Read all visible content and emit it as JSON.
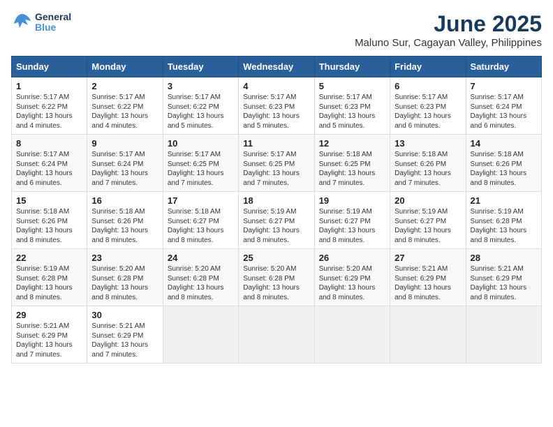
{
  "logo": {
    "line1": "General",
    "line2": "Blue"
  },
  "title": "June 2025",
  "location": "Maluno Sur, Cagayan Valley, Philippines",
  "days_header": [
    "Sunday",
    "Monday",
    "Tuesday",
    "Wednesday",
    "Thursday",
    "Friday",
    "Saturday"
  ],
  "weeks": [
    [
      {
        "day": "1",
        "sunrise": "5:17 AM",
        "sunset": "6:22 PM",
        "daylight": "13 hours and 4 minutes."
      },
      {
        "day": "2",
        "sunrise": "5:17 AM",
        "sunset": "6:22 PM",
        "daylight": "13 hours and 4 minutes."
      },
      {
        "day": "3",
        "sunrise": "5:17 AM",
        "sunset": "6:22 PM",
        "daylight": "13 hours and 5 minutes."
      },
      {
        "day": "4",
        "sunrise": "5:17 AM",
        "sunset": "6:23 PM",
        "daylight": "13 hours and 5 minutes."
      },
      {
        "day": "5",
        "sunrise": "5:17 AM",
        "sunset": "6:23 PM",
        "daylight": "13 hours and 5 minutes."
      },
      {
        "day": "6",
        "sunrise": "5:17 AM",
        "sunset": "6:23 PM",
        "daylight": "13 hours and 6 minutes."
      },
      {
        "day": "7",
        "sunrise": "5:17 AM",
        "sunset": "6:24 PM",
        "daylight": "13 hours and 6 minutes."
      }
    ],
    [
      {
        "day": "8",
        "sunrise": "5:17 AM",
        "sunset": "6:24 PM",
        "daylight": "13 hours and 6 minutes."
      },
      {
        "day": "9",
        "sunrise": "5:17 AM",
        "sunset": "6:24 PM",
        "daylight": "13 hours and 7 minutes."
      },
      {
        "day": "10",
        "sunrise": "5:17 AM",
        "sunset": "6:25 PM",
        "daylight": "13 hours and 7 minutes."
      },
      {
        "day": "11",
        "sunrise": "5:17 AM",
        "sunset": "6:25 PM",
        "daylight": "13 hours and 7 minutes."
      },
      {
        "day": "12",
        "sunrise": "5:18 AM",
        "sunset": "6:25 PM",
        "daylight": "13 hours and 7 minutes."
      },
      {
        "day": "13",
        "sunrise": "5:18 AM",
        "sunset": "6:26 PM",
        "daylight": "13 hours and 7 minutes."
      },
      {
        "day": "14",
        "sunrise": "5:18 AM",
        "sunset": "6:26 PM",
        "daylight": "13 hours and 8 minutes."
      }
    ],
    [
      {
        "day": "15",
        "sunrise": "5:18 AM",
        "sunset": "6:26 PM",
        "daylight": "13 hours and 8 minutes."
      },
      {
        "day": "16",
        "sunrise": "5:18 AM",
        "sunset": "6:26 PM",
        "daylight": "13 hours and 8 minutes."
      },
      {
        "day": "17",
        "sunrise": "5:18 AM",
        "sunset": "6:27 PM",
        "daylight": "13 hours and 8 minutes."
      },
      {
        "day": "18",
        "sunrise": "5:19 AM",
        "sunset": "6:27 PM",
        "daylight": "13 hours and 8 minutes."
      },
      {
        "day": "19",
        "sunrise": "5:19 AM",
        "sunset": "6:27 PM",
        "daylight": "13 hours and 8 minutes."
      },
      {
        "day": "20",
        "sunrise": "5:19 AM",
        "sunset": "6:27 PM",
        "daylight": "13 hours and 8 minutes."
      },
      {
        "day": "21",
        "sunrise": "5:19 AM",
        "sunset": "6:28 PM",
        "daylight": "13 hours and 8 minutes."
      }
    ],
    [
      {
        "day": "22",
        "sunrise": "5:19 AM",
        "sunset": "6:28 PM",
        "daylight": "13 hours and 8 minutes."
      },
      {
        "day": "23",
        "sunrise": "5:20 AM",
        "sunset": "6:28 PM",
        "daylight": "13 hours and 8 minutes."
      },
      {
        "day": "24",
        "sunrise": "5:20 AM",
        "sunset": "6:28 PM",
        "daylight": "13 hours and 8 minutes."
      },
      {
        "day": "25",
        "sunrise": "5:20 AM",
        "sunset": "6:28 PM",
        "daylight": "13 hours and 8 minutes."
      },
      {
        "day": "26",
        "sunrise": "5:20 AM",
        "sunset": "6:29 PM",
        "daylight": "13 hours and 8 minutes."
      },
      {
        "day": "27",
        "sunrise": "5:21 AM",
        "sunset": "6:29 PM",
        "daylight": "13 hours and 8 minutes."
      },
      {
        "day": "28",
        "sunrise": "5:21 AM",
        "sunset": "6:29 PM",
        "daylight": "13 hours and 8 minutes."
      }
    ],
    [
      {
        "day": "29",
        "sunrise": "5:21 AM",
        "sunset": "6:29 PM",
        "daylight": "13 hours and 7 minutes."
      },
      {
        "day": "30",
        "sunrise": "5:21 AM",
        "sunset": "6:29 PM",
        "daylight": "13 hours and 7 minutes."
      },
      null,
      null,
      null,
      null,
      null
    ]
  ]
}
